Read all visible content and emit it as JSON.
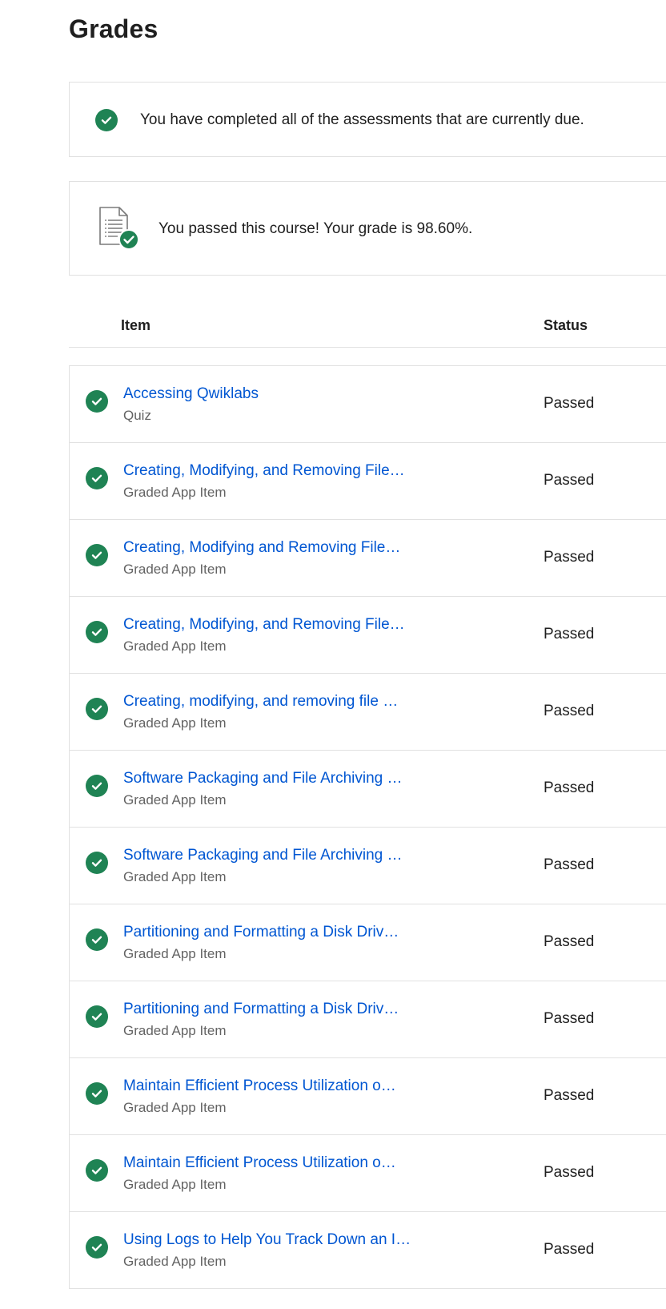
{
  "page": {
    "title": "Grades"
  },
  "due_notice": {
    "icon": "check-circle-icon",
    "text": "You have completed all of the assessments that are currently due."
  },
  "pass_notice": {
    "icon": "document-check-icon",
    "text": "You passed this course! Your grade is 98.60%."
  },
  "table": {
    "columns": {
      "item": "Item",
      "status": "Status"
    },
    "rows": [
      {
        "title": "Accessing Qwiklabs",
        "type": "Quiz",
        "status": "Passed"
      },
      {
        "title": "Creating, Modifying, and Removing File…",
        "type": "Graded App Item",
        "status": "Passed"
      },
      {
        "title": "Creating, Modifying and Removing File…",
        "type": "Graded App Item",
        "status": "Passed"
      },
      {
        "title": "Creating, Modifying, and Removing File…",
        "type": "Graded App Item",
        "status": "Passed"
      },
      {
        "title": "Creating, modifying, and removing file …",
        "type": "Graded App Item",
        "status": "Passed"
      },
      {
        "title": "Software Packaging and File Archiving …",
        "type": "Graded App Item",
        "status": "Passed"
      },
      {
        "title": "Software Packaging and File Archiving …",
        "type": "Graded App Item",
        "status": "Passed"
      },
      {
        "title": "Partitioning and Formatting a Disk Driv…",
        "type": "Graded App Item",
        "status": "Passed"
      },
      {
        "title": "Partitioning and Formatting a Disk Driv…",
        "type": "Graded App Item",
        "status": "Passed"
      },
      {
        "title": "Maintain Efficient Process Utilization o…",
        "type": "Graded App Item",
        "status": "Passed"
      },
      {
        "title": "Maintain Efficient Process Utilization o…",
        "type": "Graded App Item",
        "status": "Passed"
      },
      {
        "title": "Using Logs to Help You Track Down an I…",
        "type": "Graded App Item",
        "status": "Passed"
      }
    ]
  },
  "colors": {
    "accent_link": "#0056d2",
    "success_green": "#1f8354",
    "border": "#e1e1e1"
  }
}
